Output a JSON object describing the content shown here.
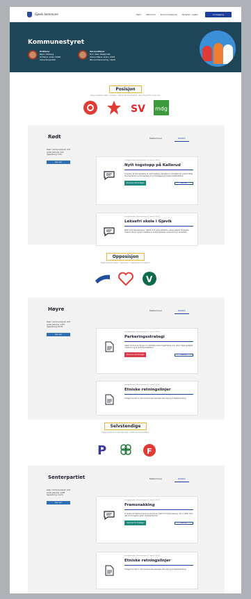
{
  "header": {
    "brand": "Gjøvik kommune",
    "nav": [
      "Hjem",
      "Økonomi",
      "Kommunestyret",
      "Nyheter i saken"
    ],
    "cta": "Innlogging"
  },
  "hero": {
    "title": "Kommunestyret",
    "mayor": {
      "role": "Ordfører",
      "name": "Bjørn Iddberg",
      "since": "Ordfører siden 2008",
      "party": "Arbeiderpartiet"
    },
    "deputy": {
      "role": "Varaordfører",
      "name": "Finn Olav Raitjordet",
      "since": "Varaordfører siden 2015",
      "party": "Økonomiansvarlig i Rødt"
    }
  },
  "sections": [
    {
      "title": "Posisjon",
      "subtitle": "Disse partiene sitter i posisjon i Gjøvik kommunestyre. Velg et parti for å se mer.",
      "parties": [
        {
          "name": "Arbeiderpartiet",
          "color": "#e23a34",
          "icon": "rose-icon"
        },
        {
          "name": "Rødt",
          "color": "#e23a34",
          "icon": "star-icon"
        },
        {
          "name": "SV",
          "color": "#e0262a",
          "icon": "sv-icon"
        },
        {
          "name": "MDG",
          "color": "#3b9a3c",
          "icon": "mdg-icon"
        }
      ]
    },
    {
      "title": "Opposisjon",
      "subtitle": "Disse partiene sitter i opposisjon i Gjøvik kommunestyre.",
      "parties": [
        {
          "name": "Høyre",
          "color": "#1d4f9c",
          "icon": "hoyre-icon"
        },
        {
          "name": "KrF",
          "color": "#e23a34",
          "icon": "heart-icon"
        },
        {
          "name": "Venstre",
          "color": "#0c6c4a",
          "icon": "v-icon"
        }
      ]
    },
    {
      "title": "Selvstendige",
      "subtitle": "Disse partiene er selvstendige i Gjøvik kommunestyre.",
      "parties": [
        {
          "name": "Pensjonistpartiet",
          "color": "#3a3a9a",
          "icon": "p-icon"
        },
        {
          "name": "Senterpartiet",
          "color": "#1f7a3a",
          "icon": "clover-icon"
        },
        {
          "name": "FrP",
          "color": "#e23a34",
          "icon": "frp-icon"
        }
      ]
    }
  ],
  "panels": [
    {
      "name": "Rødt",
      "tabs": [
        "Medlemmer",
        "Politikk"
      ],
      "stats": {
        "seats": "Seter i kommunestyret: 2/47",
        "members": "Antall stemmer: 612",
        "share": "Oppslutning: 5,9%"
      },
      "stats_button": "Les mer",
      "cards": [
        {
          "meta": "Innlegg/Forslag · Kommunestyre 22. mars kl 09:00",
          "title": "Nytt togstopp på Kallerud",
          "body": "Vi ønsker at det opprettes et nytt togstopp på Kallerud. Området har vokst kraftig de siste årene og et togstopp vil gi innbyggere et bedre kollektivtilbud.",
          "btn": "Stemmer mot forslaget",
          "link": "Les mer"
        },
        {
          "meta": "Innlegg/Forslag · Kommunestyre 22. mars kl 09:00",
          "title": "Leksefri skole i Gjøvik",
          "body": "Rødt vil at barneskolene i Gjøvik skal være leksefrie. Lekser skaper forskjeller mellom elever og bør erstattes av bedre tilpasset undervisning i skoletiden."
        }
      ]
    },
    {
      "name": "Høyre",
      "tabs": [
        "Medlemmer",
        "Politikk"
      ],
      "stats": {
        "seats": "Seter i kommunestyret: 6/47",
        "members": "Antall stemmer: 2107",
        "share": "Oppslutning: 18,0%"
      },
      "stats_button": "Les mer",
      "cards": [
        {
          "meta": "Innlegg/Forslag · Kommunestyre 22. mars kl 09:00",
          "title": "Parkeringsstrategi",
          "body": "Gjøvik kommune trenger en helhetlig parkeringsstrategi som sikrer tilgjengelighet i sentrum og et godt handelstilbud.",
          "btn": "Stemmer mot forslaget",
          "link": "Les mer"
        },
        {
          "meta": "Innlegg/Forslag · Kommunestyre 22. mars kl 09:00",
          "title": "Etniske retningslinjer",
          "body": "Tillegg til punkt 4: Alle kommunale tjenester skal sikre god likebehandling."
        }
      ]
    },
    {
      "name": "Senterpartiet",
      "tabs": [
        "Medlemmer",
        "Politikk"
      ],
      "stats": {
        "seats": "Seter i kommunestyret: 4/47",
        "members": "Antall stemmer: 1498",
        "share": "Oppslutning: 12,2%"
      },
      "stats_button": "Les mer",
      "cards": [
        {
          "meta": "Innlegg/Forslag · Kommunestyre 22. mars kl 09:00",
          "title": "Framsnakking",
          "body": "Vi ønsker at Gjøvik kommune skal ha en kultur for framsnakking, der vi løfter fram det som fungerer godt i lokalsamfunnet.",
          "btn": "Stemmer for forslaget",
          "link": "Les mer"
        },
        {
          "meta": "Innlegg/Forslag · Kommunestyre 22. mars kl 09:00",
          "title": "Etniske retningslinjer",
          "body": "Tillegg til punkt 4: Alle kommunale tjenester skal sikre god likebehandling."
        }
      ]
    }
  ],
  "colors": {
    "accent": "#1e3e9e",
    "hero": "#1f4558",
    "green_btn": "#1f8a80",
    "red_btn": "#d83a4a",
    "section_pill_border": "#e6b23a"
  }
}
